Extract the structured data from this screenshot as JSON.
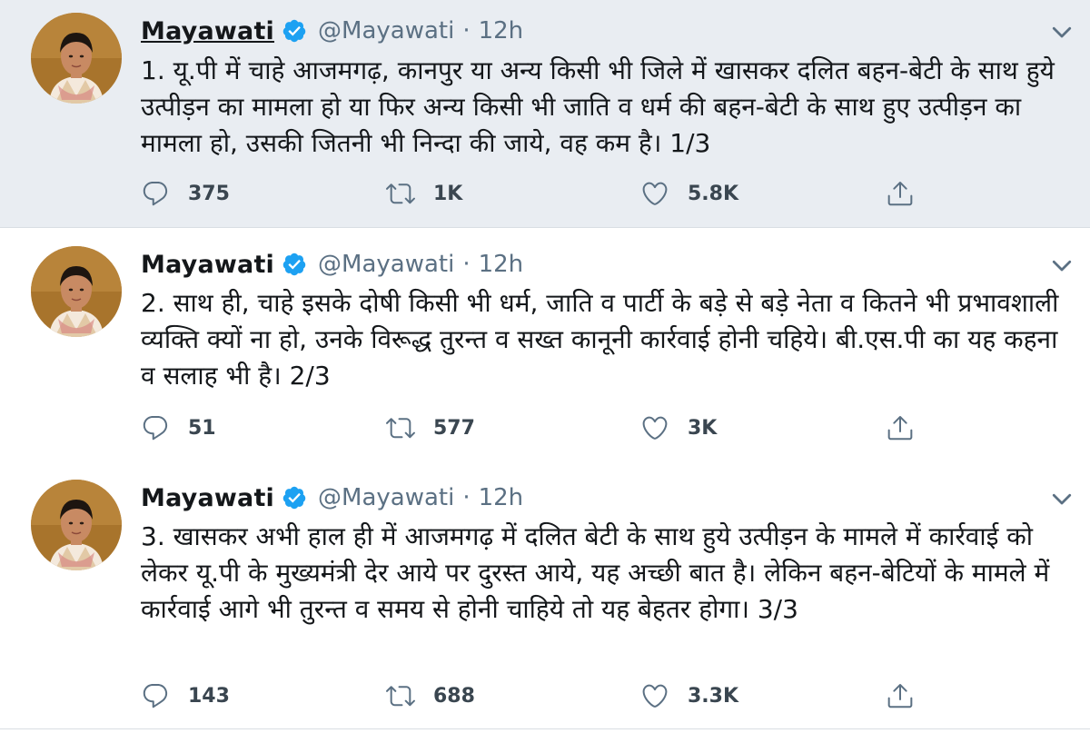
{
  "colors": {
    "highlight_bg": "#e9edf2",
    "thread_line": "#c7ced5",
    "verified_badge": "#1da1f2",
    "secondary_text": "#5b7083",
    "icon": "#5b7083"
  },
  "icons": {
    "reply": "reply-icon",
    "retweet": "retweet-icon",
    "like": "heart-icon",
    "share": "share-icon",
    "more": "chevron-down-icon",
    "verified": "verified-badge-icon"
  },
  "tweets": [
    {
      "name": "Mayawati",
      "handle": "@Mayawati",
      "separator": "·",
      "time": "12h",
      "text": "1. यू.पी में चाहे आजमगढ़, कानपुर या अन्य किसी भी जिले में खासकर दलित बहन-बेटी के साथ हुये उत्पीड़न का मामला हो या फिर अन्य किसी भी जाति व धर्म की बहन-बेटी के साथ हुए उत्पीड़न का मामला हो, उसकी जितनी भी निन्दा की जाये, वह कम है। 1/3",
      "replies": "375",
      "retweets": "1K",
      "likes": "5.8K"
    },
    {
      "name": "Mayawati",
      "handle": "@Mayawati",
      "separator": "·",
      "time": "12h",
      "text": "2. साथ ही, चाहे इसके दोषी किसी भी धर्म, जाति व पार्टी के बड़े से बड़े नेता व कितने भी प्रभावशाली व्यक्ति क्यों ना हो, उनके विरूद्ध तुरन्त व सख्त कानूनी कार्रवाई होनी चहिये। बी.एस.पी का यह कहना व सलाह भी है। 2/3",
      "replies": "51",
      "retweets": "577",
      "likes": "3K"
    },
    {
      "name": "Mayawati",
      "handle": "@Mayawati",
      "separator": "·",
      "time": "12h",
      "text": "3. खासकर अभी हाल ही में आजमगढ़ में दलित बेटी के साथ हुये उत्पीड़न के मामले में कार्रवाई को लेकर यू.पी के मुख्यमंत्री देर आये  पर दुरस्त आये, यह अच्छी बात है। लेकिन बहन-बेटियों के मामले में कार्रवाई आगे भी तुरन्त व समय से होनी चाहिये तो यह बेहतर होगा। 3/3",
      "replies": "143",
      "retweets": "688",
      "likes": "3.3K"
    }
  ]
}
